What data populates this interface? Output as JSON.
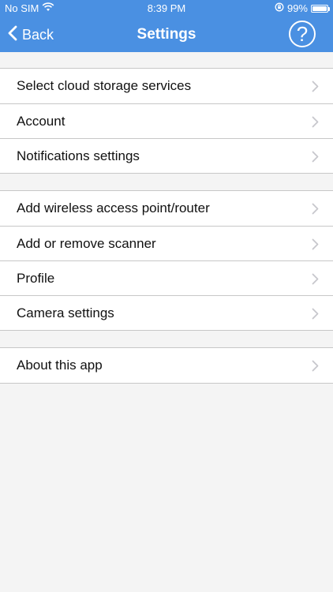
{
  "status_bar": {
    "carrier": "No SIM",
    "time": "8:39 PM",
    "battery": "99%",
    "battery_level": 0.99
  },
  "navbar": {
    "back_label": "Back",
    "title": "Settings",
    "help_label": "?"
  },
  "sections": [
    {
      "items": [
        {
          "label": "Select cloud storage services"
        },
        {
          "label": "Account"
        },
        {
          "label": "Notifications settings"
        }
      ]
    },
    {
      "items": [
        {
          "label": "Add wireless access point/router"
        },
        {
          "label": "Add or remove scanner"
        },
        {
          "label": "Profile"
        },
        {
          "label": "Camera settings"
        }
      ]
    },
    {
      "items": [
        {
          "label": "About this app"
        }
      ]
    }
  ],
  "colors": {
    "header": "#4a90e2",
    "background": "#f4f4f4",
    "divider": "#c7c7c7",
    "chevron": "#c7c7cc"
  },
  "icons": {
    "wifi": "wifi-icon",
    "orientation_lock": "orientation-lock-icon",
    "battery": "battery-icon",
    "back": "chevron-left-icon",
    "help": "question-mark-icon",
    "row_disclosure": "chevron-right-icon"
  }
}
